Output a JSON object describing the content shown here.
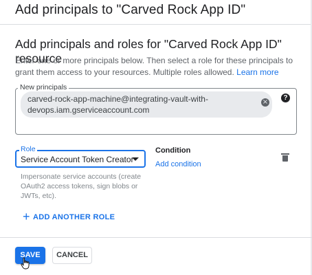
{
  "dialog": {
    "title": "Add principals to \"Carved Rock App ID\"",
    "section_title": "Add principals and roles for \"Carved Rock App ID\" resource",
    "description": "Enter one or more principals below. Then select a role for these principals to grant them access to your resources. Multiple roles allowed.",
    "learn_more": "Learn more"
  },
  "principals": {
    "label": "New principals",
    "chips": [
      {
        "value": "carved-rock-app-machine@integrating-vault-with-devops.iam.gserviceaccount.com"
      }
    ],
    "chip_line1": "carved-rock-app-machine@integrating-vault-with-",
    "chip_line2": "devops.iam.gserviceaccount.com",
    "remove_icon": "cancel-icon",
    "help_icon": "help-icon"
  },
  "role": {
    "label": "Role",
    "selected": "Service Account Token Creator",
    "help_text": "Impersonate service accounts (create OAuth2 access tokens, sign blobs or JWTs, etc).",
    "condition_title": "Condition",
    "add_condition": "Add condition",
    "delete_icon": "trash-icon"
  },
  "add_another_role": "ADD ANOTHER ROLE",
  "actions": {
    "save": "SAVE",
    "cancel": "CANCEL"
  },
  "colors": {
    "accent": "#1a73e8",
    "text": "#202124",
    "muted": "#5f6368"
  }
}
